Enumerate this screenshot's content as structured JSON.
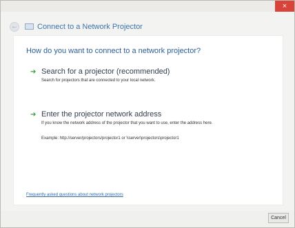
{
  "window": {
    "title": "Connect to a Network Projector",
    "close_symbol": "×"
  },
  "main": {
    "heading": "How do you want to connect to a network projector?",
    "options": [
      {
        "title": "Search for a projector (recommended)",
        "description": "Search for projectors that are connected to your local network."
      },
      {
        "title": "Enter the projector network address",
        "description": "If you know the network address of the projector that you want to use, enter the address here.",
        "example": "Example: http://server/projectors/projector1 or \\\\server\\projectors\\projector1"
      }
    ],
    "faq_link": "Frequently asked questions about network projectors"
  },
  "footer": {
    "cancel_label": "Cancel"
  },
  "colors": {
    "accent": "#2a5e98",
    "close": "#d9433a",
    "arrow": "#3b9a3b"
  },
  "icons": {
    "back": "back-arrow-icon",
    "app": "network-projector-icon",
    "option": "green-arrow-icon",
    "close": "close-icon"
  }
}
